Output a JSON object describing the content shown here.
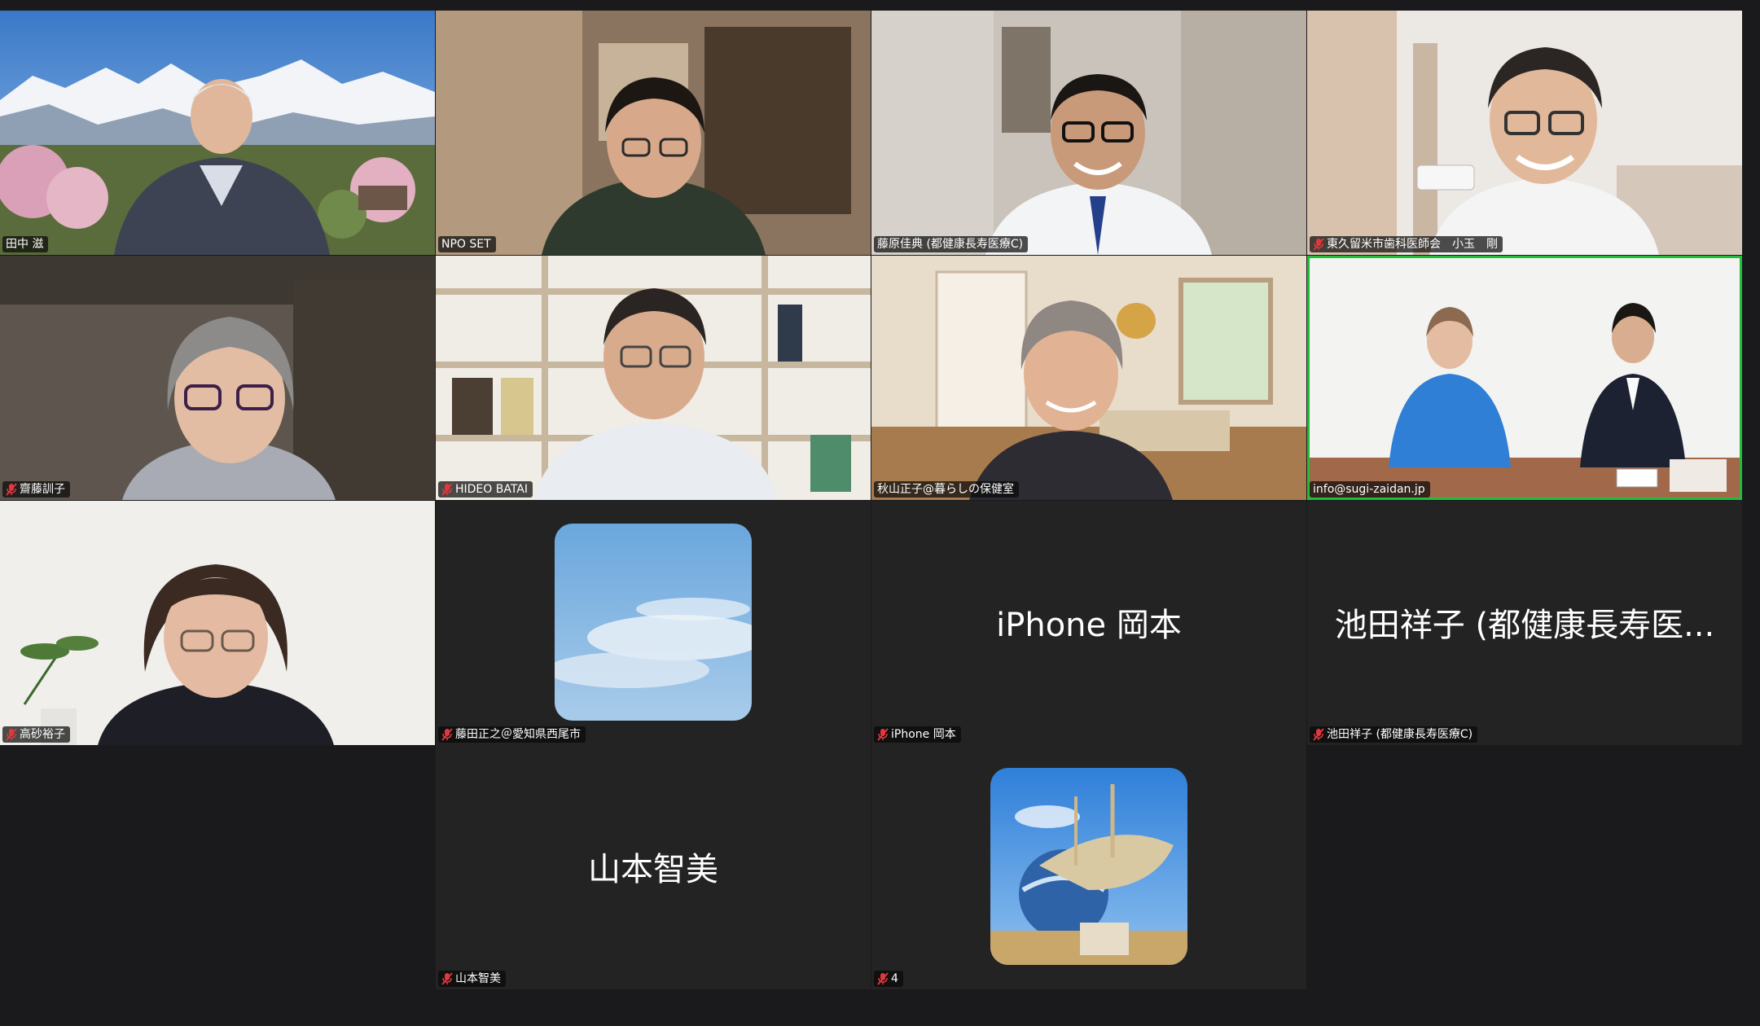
{
  "participants": [
    {
      "name": "田中 滋",
      "muted": false
    },
    {
      "name": "NPO SET",
      "muted": false
    },
    {
      "name": "藤原佳典 (都健康長寿医療C)",
      "muted": false
    },
    {
      "name": "東久留米市歯科医師会　小玉　剛",
      "muted": true
    },
    {
      "name": "齋藤訓子",
      "muted": true
    },
    {
      "name": "HIDEO BATAI",
      "muted": true
    },
    {
      "name": "秋山正子@暮らしの保健室",
      "muted": false
    },
    {
      "name": "info@sugi-zaidan.jp",
      "muted": false,
      "active_speaker": true
    },
    {
      "name": "高砂裕子",
      "muted": true
    },
    {
      "name": "藤田正之＠愛知県西尾市",
      "muted": true,
      "avatar": "sky-photo-avatar"
    },
    {
      "name": "iPhone 岡本",
      "muted": true,
      "display_name": "iPhone 岡本"
    },
    {
      "name": "池田祥子 (都健康長寿医療C)",
      "muted": true,
      "display_name": "池田祥子 (都健康長寿医..."
    },
    {
      "name": "山本智美",
      "muted": true,
      "display_name": "山本智美"
    },
    {
      "name": "4",
      "muted": true,
      "avatar": "theme-park-photo-avatar"
    }
  ],
  "colors": {
    "active_border": "#1fbf3a",
    "mute_icon": "#e0383e",
    "tile_bg": "#232323",
    "page_bg": "#1a1a1c"
  }
}
